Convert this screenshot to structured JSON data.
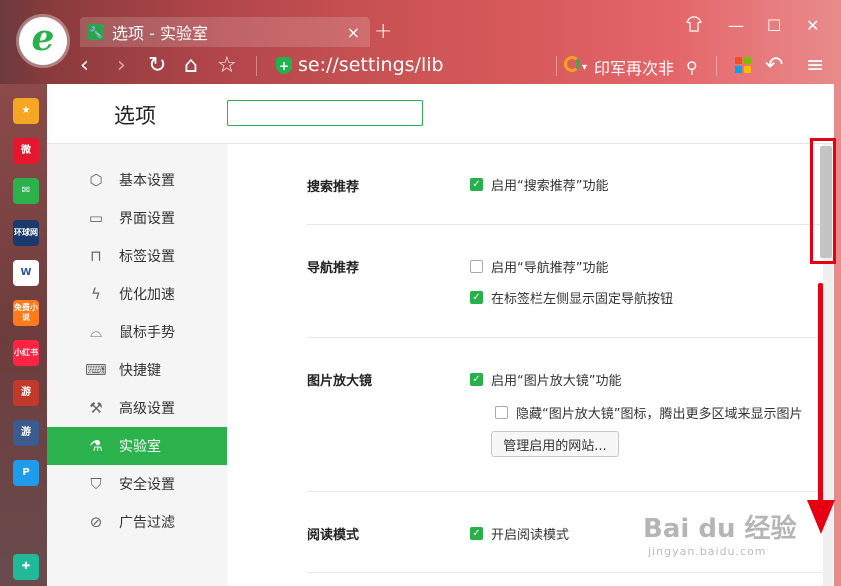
{
  "tab": {
    "title": "选项 - 实验室",
    "close": "×",
    "new_tab": "+"
  },
  "window": {
    "skin": "☐",
    "minimize": "—",
    "maximize": "☐",
    "close": "✕"
  },
  "toolbar": {
    "back": "‹",
    "forward": "›",
    "reload": "↻",
    "home": "⌂",
    "favorite": "☆",
    "url": "se://settings/lib",
    "search_text": "印军再次非",
    "menu": "≡",
    "undo": "↶"
  },
  "dock": {
    "items": [
      {
        "icon": "favorites-icon",
        "label": "★",
        "color": "#f5a623"
      },
      {
        "icon": "weibo-icon",
        "label": "微",
        "color": "#e6162d"
      },
      {
        "icon": "mail-icon",
        "label": "✉",
        "color": "#2bb24c"
      },
      {
        "icon": "global-times-icon",
        "label": "环球网",
        "color": "#1a3a6b"
      },
      {
        "icon": "word-icon",
        "label": "W",
        "color": "#ffffff"
      },
      {
        "icon": "free-novel-icon",
        "label": "免费小说",
        "color": "#ff7a1a"
      },
      {
        "icon": "xiaohongshu-icon",
        "label": "小红书",
        "color": "#ff2442"
      },
      {
        "icon": "game-icon",
        "label": "游",
        "color": "#c0392b"
      },
      {
        "icon": "game2-icon",
        "label": "游",
        "color": "#3b5b8f"
      },
      {
        "icon": "app-icon",
        "label": "P",
        "color": "#1e9be9"
      },
      {
        "icon": "tool-icon",
        "label": "✚",
        "color": "#22b89a"
      }
    ]
  },
  "settings": {
    "title": "选项",
    "search_placeholder": "",
    "nav": [
      {
        "label": "基本设置",
        "icon": "⬡"
      },
      {
        "label": "界面设置",
        "icon": "▭"
      },
      {
        "label": "标签设置",
        "icon": "⊓"
      },
      {
        "label": "优化加速",
        "icon": "ϟ"
      },
      {
        "label": "鼠标手势",
        "icon": "⌓"
      },
      {
        "label": "快捷键",
        "icon": "⌨"
      },
      {
        "label": "高级设置",
        "icon": "⚒"
      },
      {
        "label": "实验室",
        "icon": "⚗"
      },
      {
        "label": "安全设置",
        "icon": "⛉"
      },
      {
        "label": "广告过滤",
        "icon": "⊘"
      }
    ],
    "active_index": 7,
    "sections": {
      "search_recommend": {
        "title": "搜索推荐",
        "opt1": "启用“搜索推荐”功能",
        "opt1_checked": true
      },
      "nav_recommend": {
        "title": "导航推荐",
        "opt1": "启用“导航推荐”功能",
        "opt1_checked": false,
        "opt2": "在标签栏左侧显示固定导航按钮",
        "opt2_checked": true
      },
      "image_zoom": {
        "title": "图片放大镜",
        "opt1": "启用“图片放大镜”功能",
        "opt1_checked": true,
        "opt2": "隐藏“图片放大镜”图标，腾出更多区域来显示图片",
        "opt2_checked": false,
        "button": "管理启用的网站..."
      },
      "reading_mode": {
        "title": "阅读模式",
        "opt1": "开启阅读模式",
        "opt1_checked": true
      }
    }
  },
  "watermark": {
    "text": "Bai du 经验",
    "sub": "jingyan.baidu.com"
  }
}
